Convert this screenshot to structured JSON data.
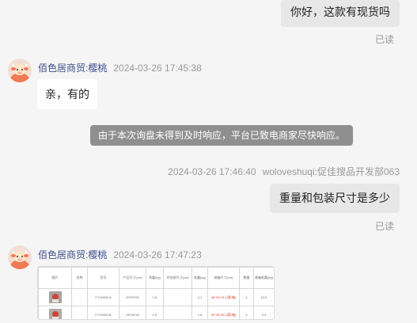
{
  "messages": {
    "msg1": {
      "text": "你好，这款有现货吗",
      "status": "已读"
    },
    "msg2": {
      "sender": "佰色居商贸:樱桃",
      "time": "2024-03-26 17:45:38",
      "text": "亲，有的"
    },
    "system_notice": "由于本次询盘未得到及时响应，平台已致电商家尽快响应。",
    "msg3": {
      "time": "2024-03-26 17:46:40",
      "sender": "woloveshuqi:促佳搜品开发部063",
      "text": "重量和包装尺寸是多少",
      "status": "已读"
    },
    "msg4": {
      "sender": "佰色居商贸:樱桃",
      "time": "2024-03-26 17:47:23",
      "image": {
        "headers": [
          "图片",
          "名称",
          "货号",
          "产品尺寸(cm)",
          "净重(kg)",
          "外包装尺寸(cm)",
          "毛重(kg)",
          "装箱尺寸(cm)",
          "数量",
          "装箱毛重(kg)"
        ],
        "rows": [
          [
            "",
            "",
            "FY21005-A",
            "30*20*20",
            "1.8",
            "",
            "2.1",
            "48*30*43 (4套/箱)",
            "4",
            "10.5"
          ],
          [
            "",
            "",
            "FY21005-B",
            "28*18*18",
            "1.5",
            "",
            "1.8",
            "45*28*40 (4套/箱)",
            "4",
            "9.3"
          ]
        ]
      }
    }
  },
  "colors": {
    "page_bg": "#f5f5f5",
    "outgoing_bubble": "#e7e7e7",
    "incoming_bubble": "#ffffff",
    "sender_name": "#3d4f8c",
    "meta_text": "#999999",
    "notice_bg": "#8f8f8f",
    "avatar_primary": "#f07a54"
  },
  "icons": {
    "avatar": "cow-avatar-icon"
  }
}
